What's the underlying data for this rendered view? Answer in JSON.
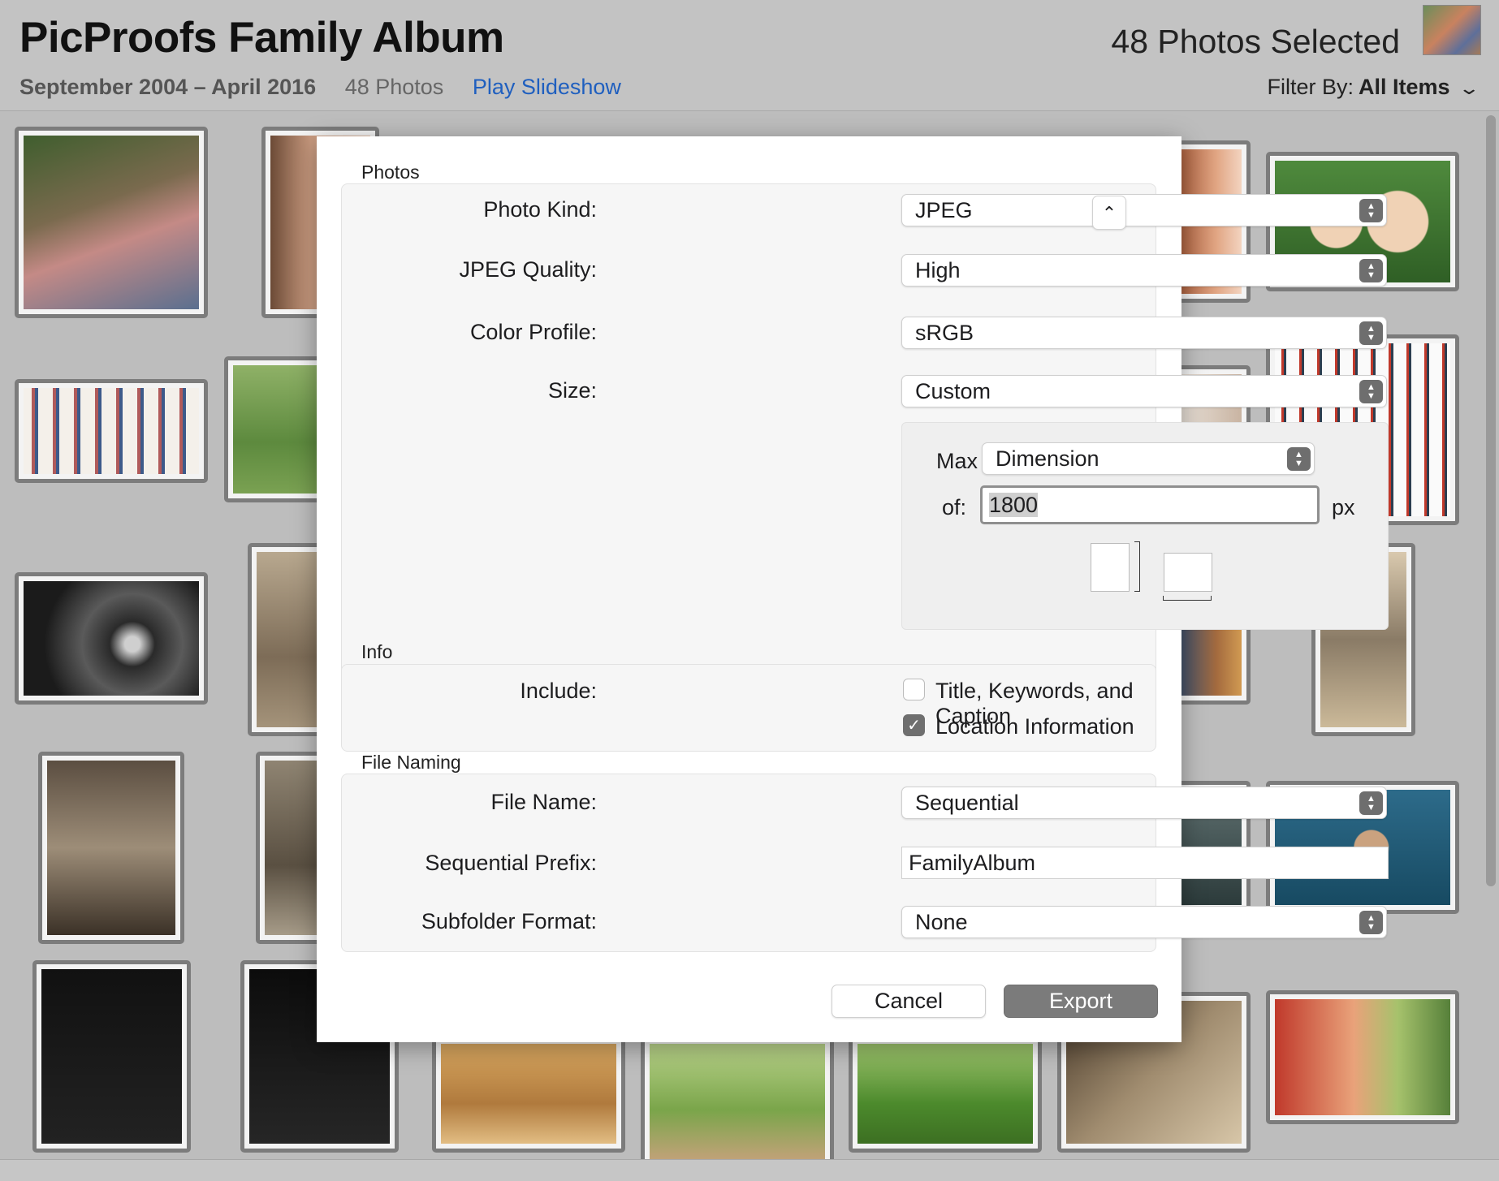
{
  "header": {
    "album_title": "PicProofs Family Album",
    "date_range": "September 2004 – April 2016",
    "photo_count": "48 Photos",
    "play_slideshow": "Play Slideshow",
    "selected_count": "48 Photos Selected",
    "filter_label": "Filter By:",
    "filter_value": "All Items"
  },
  "dialog": {
    "photos_section": {
      "title": "Photos",
      "photo_kind": {
        "label": "Photo Kind:",
        "value": "JPEG"
      },
      "jpeg_quality": {
        "label": "JPEG Quality:",
        "value": "High"
      },
      "color_profile": {
        "label": "Color Profile:",
        "value": "sRGB"
      },
      "size": {
        "label": "Size:",
        "value": "Custom"
      },
      "custom_size": {
        "max_label": "Max",
        "max_value": "Dimension",
        "of_label": "of:",
        "of_value": "1800",
        "unit": "px"
      }
    },
    "info_section": {
      "title": "Info",
      "include_label": "Include:",
      "options": [
        {
          "label": "Title, Keywords, and Caption",
          "checked": false
        },
        {
          "label": "Location Information",
          "checked": true
        }
      ]
    },
    "naming_section": {
      "title": "File Naming",
      "file_name": {
        "label": "File Name:",
        "value": "Sequential"
      },
      "sequential_prefix": {
        "label": "Sequential Prefix:",
        "value": "FamilyAlbum"
      },
      "subfolder_format": {
        "label": "Subfolder Format:",
        "value": "None"
      }
    },
    "buttons": {
      "cancel": "Cancel",
      "export": "Export"
    }
  },
  "icons": {
    "stepper": "up-down-chevron-icon",
    "collapse": "chevron-up-icon",
    "filter_dropdown": "chevron-down-icon",
    "checkmark": "checkmark-icon"
  }
}
